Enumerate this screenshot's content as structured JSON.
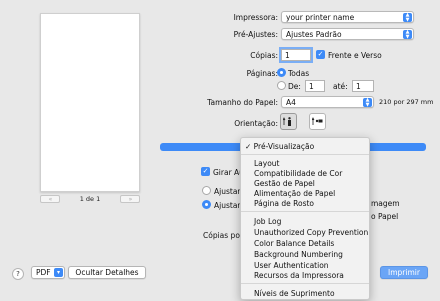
{
  "preview": {
    "page_label": "1 de 1",
    "prev_icon": "double-chevron-left",
    "next_icon": "double-chevron-right"
  },
  "printer": {
    "label": "Impressora:",
    "value": "your printer name"
  },
  "presets": {
    "label": "Pré-Ajustes:",
    "value": "Ajustes Padrão"
  },
  "copies": {
    "label": "Cópias:",
    "value": "1",
    "two_sided_label": "Frente e Verso"
  },
  "pages": {
    "label": "Páginas:",
    "all_label": "Todas",
    "from_label": "De:",
    "from_value": "1",
    "to_label": "até:",
    "to_value": "1"
  },
  "paper_size": {
    "label": "Tamanho do Papel:",
    "value": "A4",
    "dimensions": "210 por 297 mm"
  },
  "orientation": {
    "label": "Orientação:",
    "portrait_icon": "portrait-orientation-icon",
    "landscape_icon": "landscape-orientation-icon"
  },
  "behind": {
    "rotate_label": "Girar Au",
    "fit1": "Ajustar",
    "fit2": "Ajustar",
    "right1": "magem",
    "right2": "o Papel",
    "copies_per": "Cópias por"
  },
  "menu": {
    "selected": "✓ Pré-Visualização",
    "group1": [
      "Layout",
      "Compatibilidade de Cor",
      "Gestão de Papel",
      "Alimentação de Papel",
      "Página de Rosto"
    ],
    "group2": [
      "Job Log",
      "Unauthorized Copy Prevention",
      "Color Balance Details",
      "Background Numbering",
      "User Authentication",
      "Recursos da Impressora"
    ],
    "group3": [
      "Níveis de Suprimento"
    ]
  },
  "footer": {
    "help": "?",
    "pdf": "PDF",
    "hide_details": "Ocultar Detalhes",
    "print": "Imprimir"
  },
  "colors": {
    "accent": "#3d8af7",
    "print_button": "#6aa5f6",
    "background": "#e8e8e8"
  }
}
